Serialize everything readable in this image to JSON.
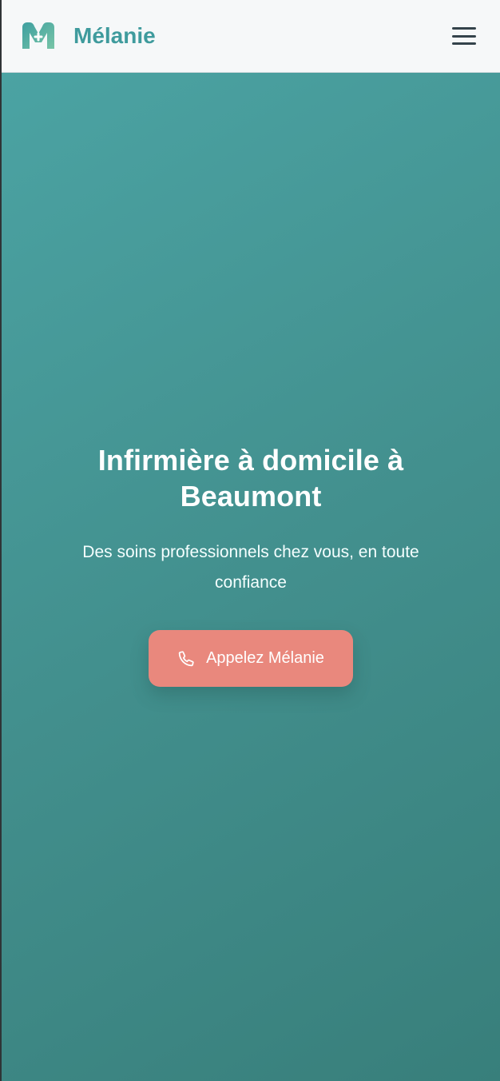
{
  "header": {
    "brand_name": "Mélanie",
    "logo_icon": "medical-m-logo-icon",
    "menu_icon": "hamburger-menu-icon"
  },
  "hero": {
    "title": "Infirmière à domicile à Beaumont",
    "subtitle": "Des soins professionnels chez vous, en toute confiance",
    "call_button_label": "Appelez Mélanie",
    "call_button_icon": "phone-icon"
  },
  "colors": {
    "brand": "#3f9b9d",
    "hero_gradient_start": "#4ba3a3",
    "hero_gradient_end": "#387f7b",
    "button": "#e9887d",
    "header_background": "#f6f8f9"
  }
}
